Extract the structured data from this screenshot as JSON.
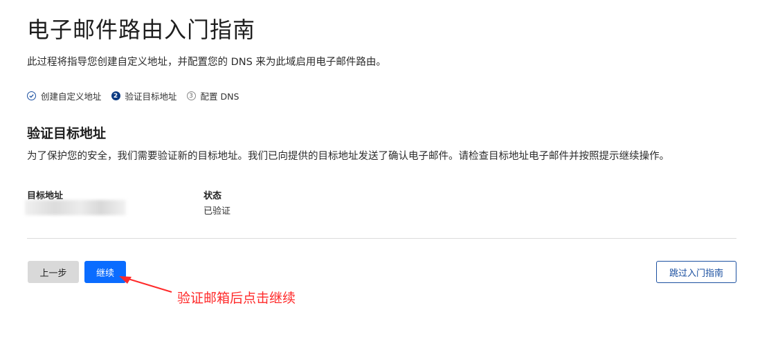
{
  "page": {
    "title": "电子邮件路由入门指南",
    "subtitle": "此过程将指导您创建自定义地址，并配置您的 DNS 来为此域启用电子邮件路由。"
  },
  "steps": [
    {
      "number": "",
      "label": "创建自定义地址",
      "state": "done",
      "icon": "check-circle-icon"
    },
    {
      "number": "2",
      "label": "验证目标地址",
      "state": "current"
    },
    {
      "number": "3",
      "label": "配置 DNS",
      "state": "todo"
    }
  ],
  "section": {
    "title": "验证目标地址",
    "description": "为了保护您的安全，我们需要验证新的目标地址。我们已向提供的目标地址发送了确认电子邮件。请检查目标地址电子邮件并按照提示继续操作。"
  },
  "fields": {
    "destination_label": "目标地址",
    "destination_value": "",
    "status_label": "状态",
    "status_value": "已验证"
  },
  "buttons": {
    "back": "上一步",
    "continue": "继续",
    "skip": "跳过入门指南"
  },
  "annotation": {
    "text": "验证邮箱后点击继续",
    "color": "#ff2a2a"
  },
  "colors": {
    "primary": "#0a6cff",
    "step_current": "#0b3a82",
    "link": "#1a4fa0"
  }
}
